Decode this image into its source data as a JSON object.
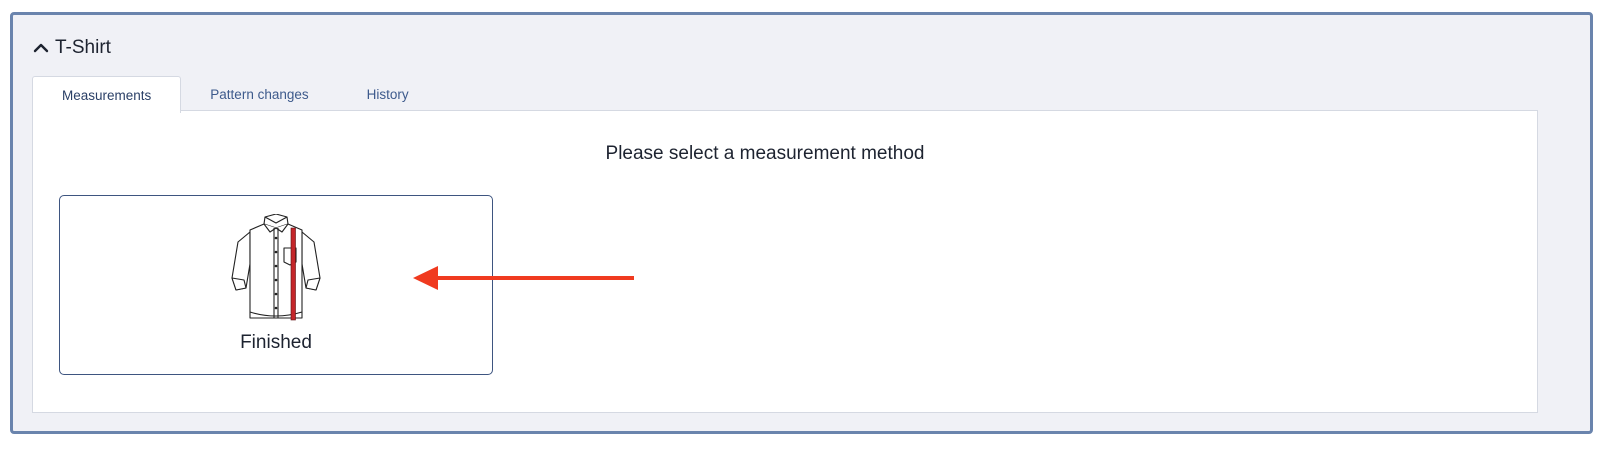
{
  "panel": {
    "title": "T-Shirt",
    "chevron_icon": "chevron-up-icon"
  },
  "tabs": [
    {
      "label": "Measurements",
      "active": true
    },
    {
      "label": "Pattern changes",
      "active": false
    },
    {
      "label": "History",
      "active": false
    }
  ],
  "content": {
    "heading": "Please select a measurement method",
    "methods": [
      {
        "label": "Finished",
        "icon": "shirt-measurement-icon"
      }
    ]
  },
  "colors": {
    "panel_border": "#6a84ad",
    "panel_bg": "#f0f1f6",
    "tab_text": "#3d5a8c",
    "card_border": "#3e5580",
    "measure_line": "#c4262a",
    "arrow": "#f03a1f"
  }
}
